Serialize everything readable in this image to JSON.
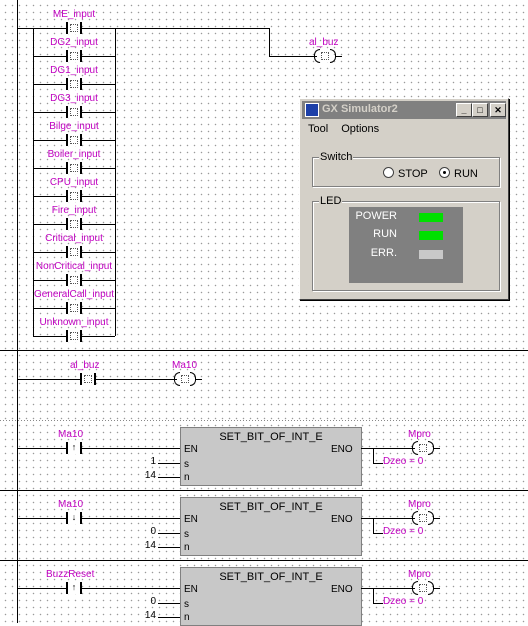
{
  "ladder": {
    "rung1": {
      "contacts": [
        "ME_input",
        "DG2_input",
        "DG1_input",
        "DG3_input",
        "Bilge_input",
        "Boiler_input",
        "CPU_input",
        "Fire_input",
        "Critical_input",
        "NonCritical_input",
        "GeneralCall_input",
        "Unknown_input"
      ],
      "coil": "al_buz"
    },
    "rung2": {
      "contact": "al_buz",
      "coil": "Ma10"
    },
    "rung3": {
      "contact": "Ma10",
      "pulse": "↑",
      "func": "SET_BIT_OF_INT_E",
      "en": "EN",
      "eno": "ENO",
      "s_pin": "s",
      "n_pin": "n",
      "s": "1",
      "n": "14",
      "out_coil": "Mpro",
      "out_var": "Dzeo = 0"
    },
    "rung4": {
      "contact": "Ma10",
      "pulse": "↓",
      "func": "SET_BIT_OF_INT_E",
      "en": "EN",
      "eno": "ENO",
      "s_pin": "s",
      "n_pin": "n",
      "s": "0",
      "n": "14",
      "out_coil": "Mpro",
      "out_var": "Dzeo = 0"
    },
    "rung5": {
      "contact": "BuzzReset",
      "pulse": "↑",
      "func": "SET_BIT_OF_INT_E",
      "en": "EN",
      "eno": "ENO",
      "s_pin": "s",
      "n_pin": "n",
      "s": "0",
      "n": "14",
      "out_coil": "Mpro",
      "out_var": "Dzeo = 0"
    }
  },
  "simulator": {
    "title": "GX Simulator2",
    "menu": [
      "Tool",
      "Options"
    ],
    "switch_label": "Switch",
    "stop_label": "STOP",
    "run_label": "RUN",
    "selected": "RUN",
    "led_label": "LED",
    "leds": [
      {
        "label": "POWER",
        "color": "#00e000"
      },
      {
        "label": "RUN",
        "color": "#00e000"
      },
      {
        "label": "ERR.",
        "color": "#c8c8c8"
      }
    ],
    "buttons": {
      "minimize": "_",
      "maximize": "□",
      "close": "✕"
    }
  }
}
